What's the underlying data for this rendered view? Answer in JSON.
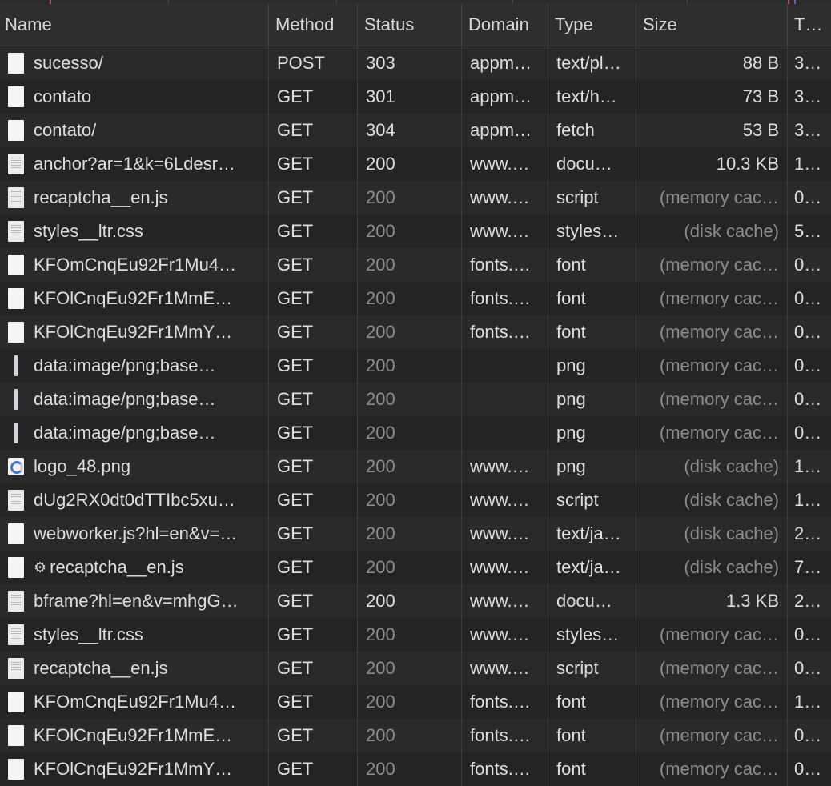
{
  "columns": {
    "name": "Name",
    "method": "Method",
    "status": "Status",
    "domain": "Domain",
    "type": "Type",
    "size": "Size",
    "time": "T…"
  },
  "rows": [
    {
      "name": "sucesso/",
      "icon": "blank",
      "method": "POST",
      "status": "303",
      "status_dim": false,
      "domain": "appm…",
      "type": "text/pl…",
      "size": "88 B",
      "size_dim": false,
      "time": "3…"
    },
    {
      "name": "contato",
      "icon": "blank",
      "method": "GET",
      "status": "301",
      "status_dim": false,
      "domain": "appm…",
      "type": "text/h…",
      "size": "73 B",
      "size_dim": false,
      "time": "3…"
    },
    {
      "name": "contato/",
      "icon": "blank",
      "method": "GET",
      "status": "304",
      "status_dim": false,
      "domain": "appm…",
      "type": "fetch",
      "size": "53 B",
      "size_dim": false,
      "time": "3…"
    },
    {
      "name": "anchor?ar=1&k=6Ldesr…",
      "icon": "doc",
      "method": "GET",
      "status": "200",
      "status_dim": false,
      "domain": "www.…",
      "type": "docu…",
      "size": "10.3 KB",
      "size_dim": false,
      "time": "1…"
    },
    {
      "name": "recaptcha__en.js",
      "icon": "doc",
      "method": "GET",
      "status": "200",
      "status_dim": true,
      "domain": "www.…",
      "type": "script",
      "size": "(memory cac…",
      "size_dim": true,
      "time": "0…"
    },
    {
      "name": "styles__ltr.css",
      "icon": "doc",
      "method": "GET",
      "status": "200",
      "status_dim": true,
      "domain": "www.…",
      "type": "styles…",
      "size": "(disk cache)",
      "size_dim": true,
      "time": "5…"
    },
    {
      "name": "KFOmCnqEu92Fr1Mu4…",
      "icon": "blank",
      "method": "GET",
      "status": "200",
      "status_dim": true,
      "domain": "fonts.…",
      "type": "font",
      "size": "(memory cac…",
      "size_dim": true,
      "time": "0…"
    },
    {
      "name": "KFOlCnqEu92Fr1MmE…",
      "icon": "blank",
      "method": "GET",
      "status": "200",
      "status_dim": true,
      "domain": "fonts.…",
      "type": "font",
      "size": "(memory cac…",
      "size_dim": true,
      "time": "0…"
    },
    {
      "name": "KFOlCnqEu92Fr1MmY…",
      "icon": "blank",
      "method": "GET",
      "status": "200",
      "status_dim": true,
      "domain": "fonts.…",
      "type": "font",
      "size": "(memory cac…",
      "size_dim": true,
      "time": "0…"
    },
    {
      "name": "data:image/png;base…",
      "icon": "img",
      "method": "GET",
      "status": "200",
      "status_dim": true,
      "domain": "",
      "type": "png",
      "size": "(memory cac…",
      "size_dim": true,
      "time": "0…"
    },
    {
      "name": "data:image/png;base…",
      "icon": "img",
      "method": "GET",
      "status": "200",
      "status_dim": true,
      "domain": "",
      "type": "png",
      "size": "(memory cac…",
      "size_dim": true,
      "time": "0…"
    },
    {
      "name": "data:image/png;base…",
      "icon": "img",
      "method": "GET",
      "status": "200",
      "status_dim": true,
      "domain": "",
      "type": "png",
      "size": "(memory cac…",
      "size_dim": true,
      "time": "0…"
    },
    {
      "name": "logo_48.png",
      "icon": "logo",
      "method": "GET",
      "status": "200",
      "status_dim": true,
      "domain": "www.…",
      "type": "png",
      "size": "(disk cache)",
      "size_dim": true,
      "time": "1…"
    },
    {
      "name": "dUg2RX0dt0dTTIbc5xu…",
      "icon": "doc",
      "method": "GET",
      "status": "200",
      "status_dim": true,
      "domain": "www.…",
      "type": "script",
      "size": "(disk cache)",
      "size_dim": true,
      "time": "1…"
    },
    {
      "name": "webworker.js?hl=en&v=…",
      "icon": "blank",
      "method": "GET",
      "status": "200",
      "status_dim": true,
      "domain": "www.…",
      "type": "text/ja…",
      "size": "(disk cache)",
      "size_dim": true,
      "time": "2…"
    },
    {
      "name": "recaptcha__en.js",
      "icon": "blank",
      "gear": "⚙",
      "method": "GET",
      "status": "200",
      "status_dim": true,
      "domain": "www.…",
      "type": "text/ja…",
      "size": "(disk cache)",
      "size_dim": true,
      "time": "7…"
    },
    {
      "name": "bframe?hl=en&v=mhgG…",
      "icon": "doc",
      "method": "GET",
      "status": "200",
      "status_dim": false,
      "domain": "www.…",
      "type": "docu…",
      "size": "1.3 KB",
      "size_dim": false,
      "time": "2…"
    },
    {
      "name": "styles__ltr.css",
      "icon": "doc",
      "method": "GET",
      "status": "200",
      "status_dim": true,
      "domain": "www.…",
      "type": "styles…",
      "size": "(memory cac…",
      "size_dim": true,
      "time": "0…"
    },
    {
      "name": "recaptcha__en.js",
      "icon": "doc",
      "method": "GET",
      "status": "200",
      "status_dim": true,
      "domain": "www.…",
      "type": "script",
      "size": "(memory cac…",
      "size_dim": true,
      "time": "0…"
    },
    {
      "name": "KFOmCnqEu92Fr1Mu4…",
      "icon": "blank",
      "method": "GET",
      "status": "200",
      "status_dim": true,
      "domain": "fonts.…",
      "type": "font",
      "size": "(memory cac…",
      "size_dim": true,
      "time": "1…"
    },
    {
      "name": "KFOlCnqEu92Fr1MmE…",
      "icon": "blank",
      "method": "GET",
      "status": "200",
      "status_dim": true,
      "domain": "fonts.…",
      "type": "font",
      "size": "(memory cac…",
      "size_dim": true,
      "time": "0…"
    },
    {
      "name": "KFOlCnqEu92Fr1MmY…",
      "icon": "blank",
      "method": "GET",
      "status": "200",
      "status_dim": true,
      "domain": "fonts.…",
      "type": "font",
      "size": "(memory cac…",
      "size_dim": true,
      "time": "0…"
    }
  ]
}
